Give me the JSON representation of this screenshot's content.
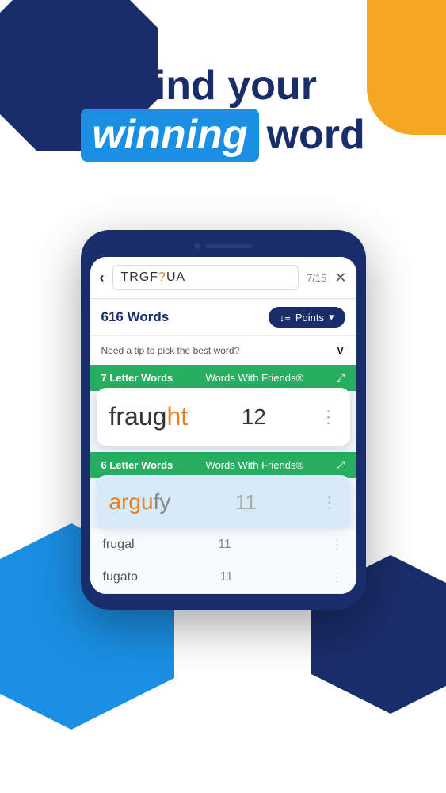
{
  "hero": {
    "line1": "Find your",
    "line2_part1": "winning",
    "line2_part2": "word"
  },
  "search": {
    "query_display": "TRGF",
    "query_wildcard": "?",
    "query_rest": "UA",
    "count": "7/15",
    "back_icon": "‹",
    "clear_icon": "✕"
  },
  "results": {
    "word_count": "616 Words",
    "sort_label": "Points",
    "sort_icon": "↓≡",
    "tip_text": "Need a tip to pick the best word?",
    "tip_icon": "∨"
  },
  "categories": [
    {
      "id": "7letter",
      "label_left": "7 Letter Words",
      "label_right": "Words With Friends®",
      "expand_icon": "⤢"
    },
    {
      "id": "6letter",
      "label_left": "6 Letter Words",
      "label_right": "Words With Friends®",
      "expand_icon": "⤢"
    }
  ],
  "words": [
    {
      "word": "fraught",
      "highlight_chars": "ht",
      "score": "12",
      "card_type": "primary"
    },
    {
      "word": "argufy",
      "highlight_chars": "",
      "score": "11",
      "card_type": "secondary"
    },
    {
      "word": "frugal",
      "highlight_chars": "",
      "score": "11",
      "card_type": "row"
    },
    {
      "word": "fugato",
      "highlight_chars": "",
      "score": "11",
      "card_type": "row"
    }
  ]
}
